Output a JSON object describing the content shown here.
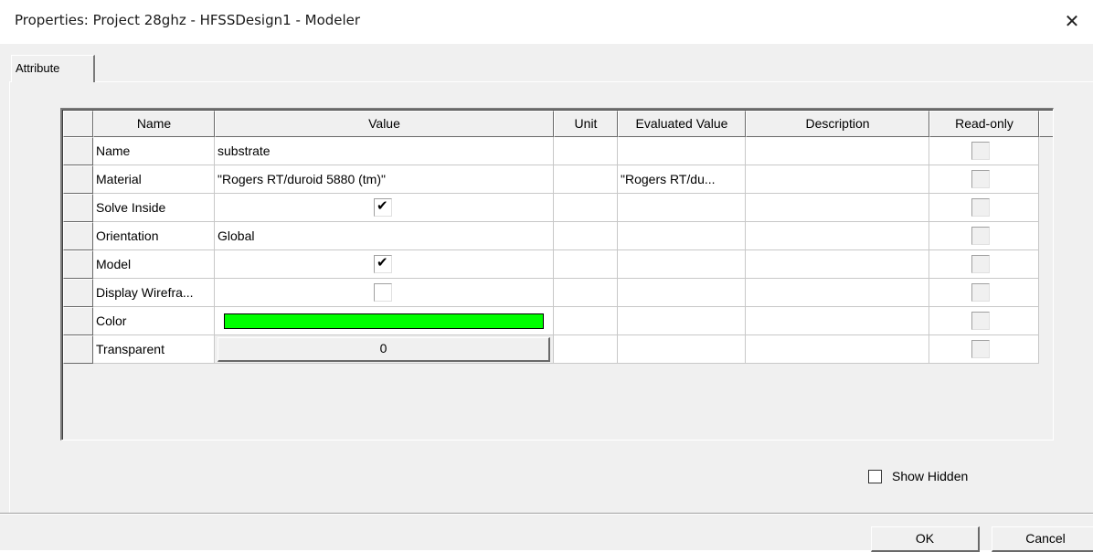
{
  "window": {
    "title": "Properties: Project 28ghz - HFSSDesign1 - Modeler",
    "close_glyph": "✕"
  },
  "tab": {
    "label": "Attribute"
  },
  "grid": {
    "columns": [
      "Name",
      "Value",
      "Unit",
      "Evaluated Value",
      "Description",
      "Read-only"
    ],
    "rows": [
      {
        "name": "Name",
        "value": "substrate",
        "unit": "",
        "evaluated": "",
        "description": "",
        "value_kind": "text",
        "read_only": false
      },
      {
        "name": "Material",
        "value": "\"Rogers RT/duroid 5880 (tm)\"",
        "unit": "",
        "evaluated": "\"Rogers RT/du...",
        "description": "",
        "value_kind": "text",
        "read_only": false
      },
      {
        "name": "Solve Inside",
        "value": "",
        "unit": "",
        "evaluated": "",
        "description": "",
        "value_kind": "checkbox",
        "checked": true,
        "read_only": false
      },
      {
        "name": "Orientation",
        "value": "Global",
        "unit": "",
        "evaluated": "",
        "description": "",
        "value_kind": "text",
        "read_only": false
      },
      {
        "name": "Model",
        "value": "",
        "unit": "",
        "evaluated": "",
        "description": "",
        "value_kind": "checkbox",
        "checked": true,
        "read_only": false
      },
      {
        "name": "Display Wirefra...",
        "value": "",
        "unit": "",
        "evaluated": "",
        "description": "",
        "value_kind": "checkbox",
        "checked": false,
        "read_only": false
      },
      {
        "name": "Color",
        "value": "",
        "unit": "",
        "evaluated": "",
        "description": "",
        "value_kind": "color",
        "color": "#00ff00",
        "read_only": false
      },
      {
        "name": "Transparent",
        "value": "0",
        "unit": "",
        "evaluated": "",
        "description": "",
        "value_kind": "button",
        "read_only": false
      }
    ]
  },
  "show_hidden": {
    "label": "Show Hidden",
    "checked": false
  },
  "buttons": {
    "ok": "OK",
    "cancel": "Cancel"
  }
}
